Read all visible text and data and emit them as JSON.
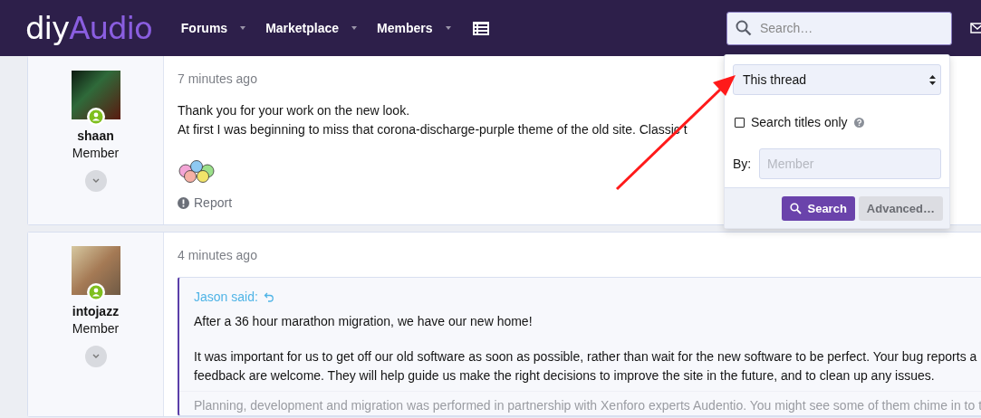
{
  "header": {
    "logo_prefix": "diy",
    "logo_suffix": "Audio",
    "nav": [
      {
        "label": "Forums",
        "kind": "menu"
      },
      {
        "label": "Marketplace",
        "kind": "menu"
      },
      {
        "label": "Members",
        "kind": "menu"
      },
      {
        "kind": "list"
      }
    ],
    "search": {
      "placeholder": "Search…"
    }
  },
  "search_menu": {
    "scope": "This thread",
    "titles_only": {
      "label": "Search titles only",
      "checked": false
    },
    "by_label": "By:",
    "member": {
      "placeholder": "Member"
    },
    "buttons": [
      {
        "label": "Search",
        "kind": "primary"
      },
      {
        "label": "Advanced…",
        "kind": "secondary"
      }
    ]
  },
  "posts": [
    {
      "username": "shaan",
      "role": "Member",
      "online": true,
      "time": "7 minutes ago",
      "lines": [
        "Thank you for your work on the new look.",
        "At first I was beginning to miss that corona-discharge-purple theme of the old site. Classic t"
      ],
      "smilies": true,
      "report": "Report"
    },
    {
      "username": "intojazz",
      "role": "Member",
      "online": true,
      "time": "4 minutes ago",
      "quote": {
        "author": "Jason said:",
        "paragraphs": [
          [
            "After a 36 hour marathon migration, we have our new home!"
          ],
          [
            "It was important for us to get off our old software as soon as possible, rather than wait for the new software to be perfect. Your bug reports a",
            "feedback are welcome. They will help guide us make the right decisions to improve the site in the future, and to clean up any issues."
          ]
        ],
        "faded": "Planning, development and migration was performed in partnership with Xenforo experts Audentio. You might see some of them chime in to t"
      }
    }
  ]
}
